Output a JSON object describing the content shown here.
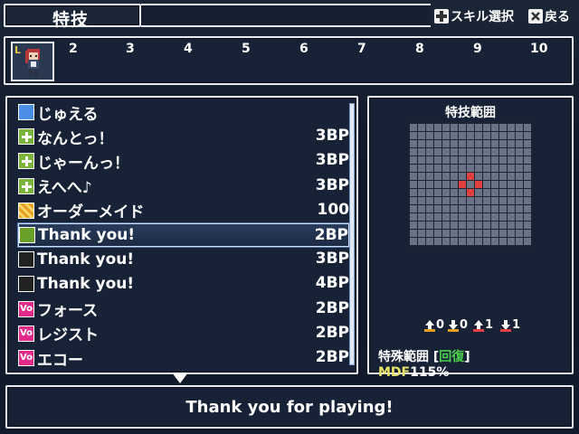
{
  "header": {
    "title": "特技",
    "hint_skill_select": "スキル選択",
    "hint_back": "戻る"
  },
  "party": {
    "leader_badge": "L",
    "slots": [
      "2",
      "3",
      "4",
      "5",
      "6",
      "7",
      "8",
      "9",
      "10"
    ]
  },
  "skills": [
    {
      "icon": "gem",
      "name": "じゅえる",
      "cost": ""
    },
    {
      "icon": "plus",
      "name": "なんとっ！",
      "cost": "3BP"
    },
    {
      "icon": "plus",
      "name": "じゃーんっ！",
      "cost": "3BP"
    },
    {
      "icon": "plus",
      "name": "えへへ♪",
      "cost": "3BP"
    },
    {
      "icon": "maid",
      "name": "オーダーメイド",
      "cost": "100"
    },
    {
      "icon": "note",
      "name": "Thank you!",
      "cost": "2BP"
    },
    {
      "icon": "note2",
      "name": "Thank you!",
      "cost": "3BP"
    },
    {
      "icon": "note2",
      "name": "Thank you!",
      "cost": "4BP"
    },
    {
      "icon": "vo",
      "name": "フォース",
      "cost": "2BP"
    },
    {
      "icon": "vo",
      "name": "レジスト",
      "cost": "2BP"
    },
    {
      "icon": "vo",
      "name": "エコー",
      "cost": "2BP"
    }
  ],
  "selected_index": 5,
  "range_panel": {
    "title": "特技範囲",
    "stats": [
      "0",
      "0",
      "1",
      "1"
    ],
    "special_prefix": "特殊範囲 [",
    "special_value": "回復",
    "special_suffix": "]",
    "mdf_key": "MDF",
    "mdf_value": "115%"
  },
  "message": "Thank you for playing!",
  "colors": {
    "panel_bg": "#172236",
    "border": "#e8ecf2",
    "accent_green": "#4cd24c",
    "accent_yellow": "#e6e26a",
    "range_red": "#e04040"
  }
}
